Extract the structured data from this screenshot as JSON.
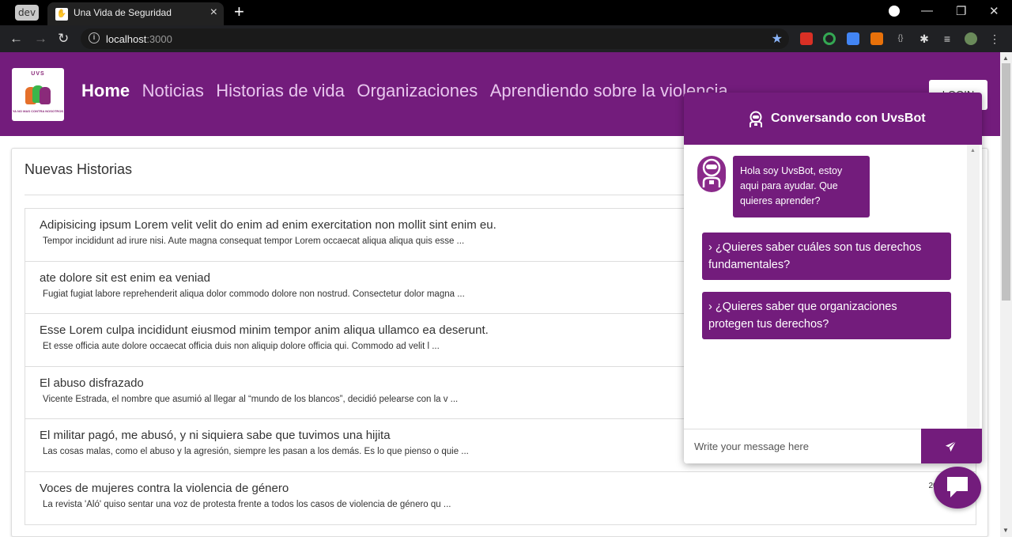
{
  "browser": {
    "profile_badge": "dev",
    "tab_title": "Una Vida de Seguridad",
    "url_host": "localhost",
    "url_port": ":3000"
  },
  "header": {
    "logo_text": "UVS",
    "logo_tag": "YA NO MAS CONTRA NOSOTROS",
    "nav": [
      "Home",
      "Noticias",
      "Historias de vida",
      "Organizaciones",
      "Aprendiendo sobre la violencia"
    ],
    "login_label": "LOGIN"
  },
  "stories": {
    "title": "Nuevas Historias",
    "items": [
      {
        "title": "Adipisicing ipsum Lorem velit velit do enim ad enim exercitation non mollit sint enim eu.",
        "excerpt": "Tempor incididunt ad irure nisi. Aute magna consequat tempor Lorem occaecat aliqua aliqua quis esse ...",
        "date": ""
      },
      {
        "title": "ate dolore sit est enim ea veniad",
        "excerpt": "Fugiat fugiat labore reprehenderit aliqua dolor commodo dolore non nostrud. Consectetur dolor magna ...",
        "date": ""
      },
      {
        "title": "Esse Lorem culpa incididunt eiusmod minim tempor anim aliqua ullamco ea deserunt.",
        "excerpt": "Et esse officia aute dolore occaecat officia duis non aliquip dolore officia qui. Commodo ad velit l ...",
        "date": ""
      },
      {
        "title": "El abuso disfrazado",
        "excerpt": "Vicente Estrada, el nombre que asumió al llegar al “mundo de los blancos”, decidió pelearse con la v ...",
        "date": ""
      },
      {
        "title": "El militar pagó, me abusó, y ni siquiera sabe que tuvimos una hijita",
        "excerpt": "Las cosas malas, como el abuso y la agresión, siempre les pasan a los demás. Es lo que pienso o quie ...",
        "date": ""
      },
      {
        "title": "Voces de mujeres contra la violencia de género",
        "excerpt": "La revista 'Aló' quiso sentar una voz de protesta frente a todos los casos de violencia de género qu ...",
        "date": "20/0"
      }
    ]
  },
  "chat": {
    "title": "Conversando con UvsBot",
    "bot_message": "Hola soy UvsBot, estoy aqui para ayudar. Que quieres aprender?",
    "options": [
      "¿Quieres saber cuáles son tus derechos fundamentales?",
      "¿Quieres saber que organizaciones protegen tus derechos?"
    ],
    "input_placeholder": "Write your message here"
  },
  "colors": {
    "brand_purple": "#731c7c"
  }
}
